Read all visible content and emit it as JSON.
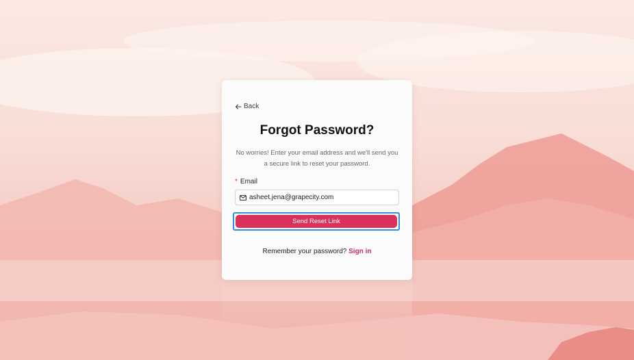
{
  "background": {
    "description_colors": [
      "#fbe9e3",
      "#f3c4bd",
      "#efb2ab"
    ]
  },
  "card": {
    "back_label": "Back",
    "title": "Forgot Password?",
    "description": "No worries! Enter your email address and we'll send you a secure link to reset your password.",
    "email": {
      "required_marker": "*",
      "label": "Email",
      "value": "asheet.jena@grapecity.com",
      "icon": "mail-icon"
    },
    "submit_label": "Send Reset Link",
    "footer": {
      "prompt": "Remember your password?",
      "link": "Sign in"
    }
  },
  "colors": {
    "accent": "#d8315b",
    "focus_ring": "#2f8fe0",
    "link": "#c8315b"
  }
}
